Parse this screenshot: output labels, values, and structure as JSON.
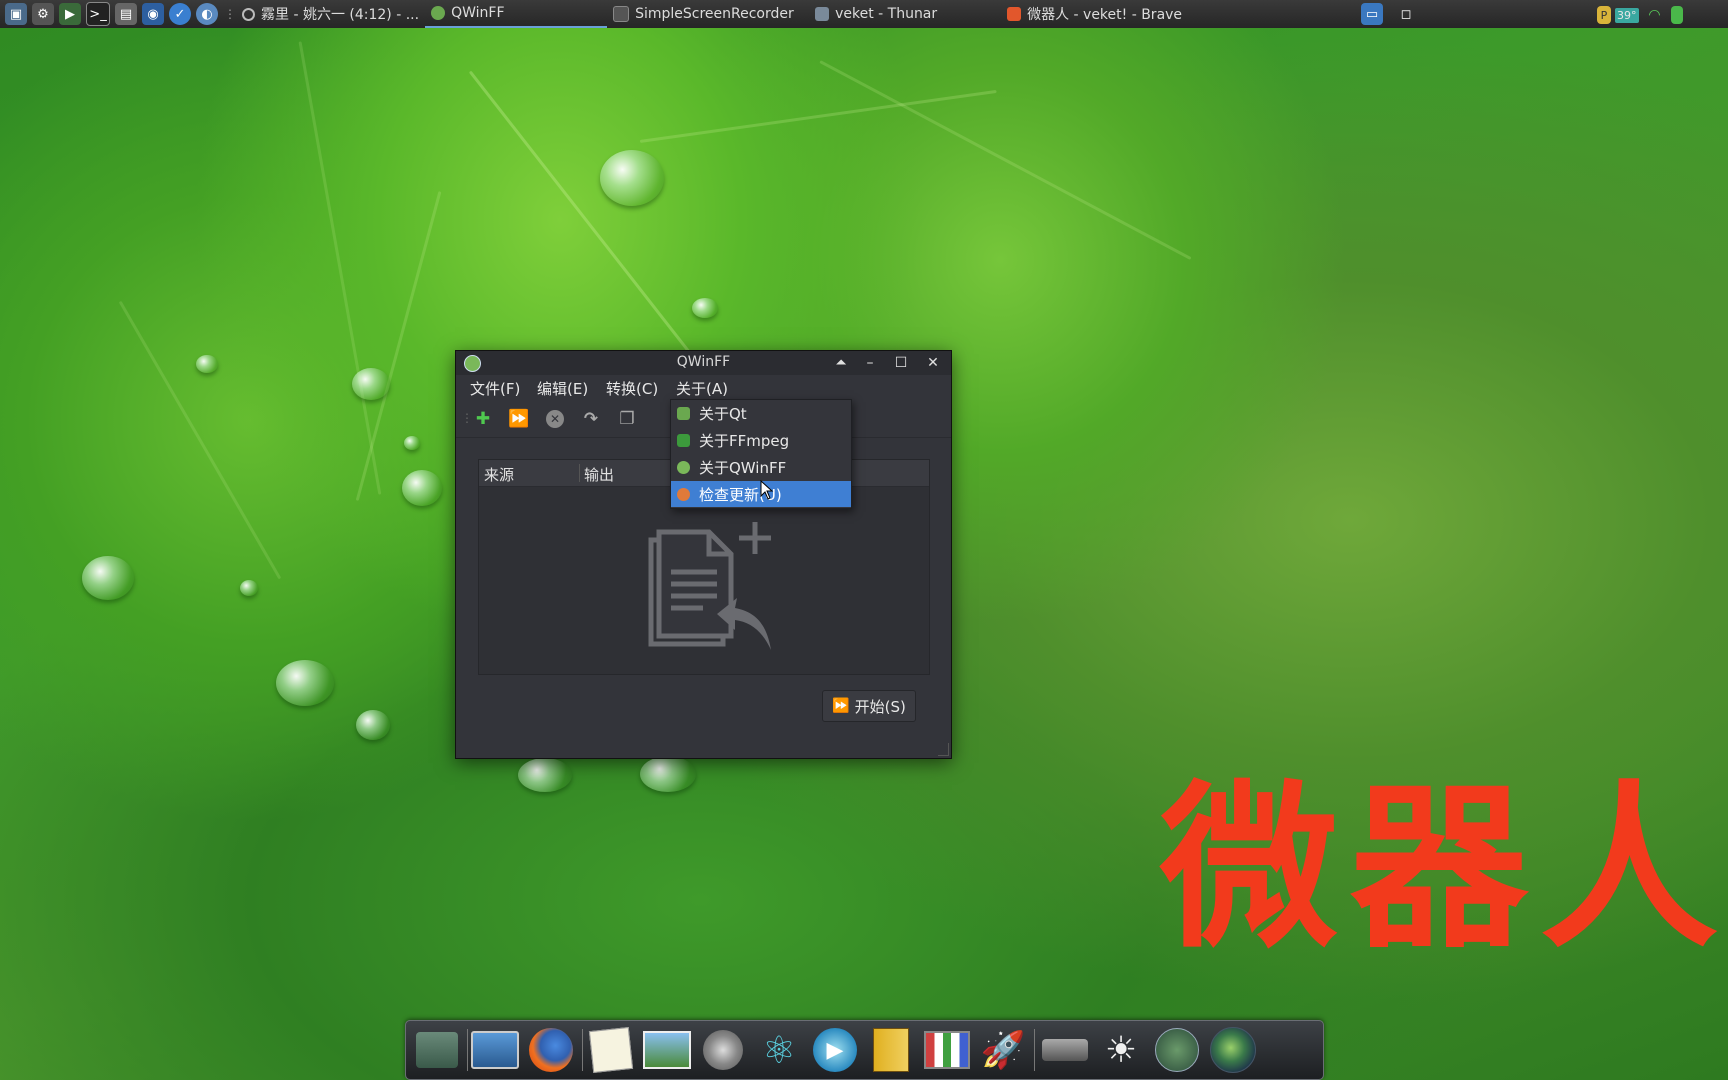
{
  "top_panel": {
    "tasks": [
      {
        "label": "霧里 - 姚六一 (4:12) - ...",
        "icon": "circle-icon"
      },
      {
        "label": "QWinFF",
        "icon": "qwinff-icon",
        "active": true
      },
      {
        "label": "SimpleScreenRecorder",
        "icon": "window-icon"
      },
      {
        "label": "veket - Thunar",
        "icon": "folder-icon"
      },
      {
        "label": "微器人 - veket! - Brave",
        "icon": "brave-icon"
      }
    ],
    "tray": {
      "temperature": "39°"
    }
  },
  "window": {
    "title": "QWinFF",
    "menu": {
      "file": "文件(F)",
      "edit": "编辑(E)",
      "convert": "转换(C)",
      "about": "关于(A)"
    },
    "list": {
      "col_source": "来源",
      "col_output": "输出"
    },
    "start_button": "开始(S)"
  },
  "about_menu": {
    "items": [
      {
        "label": "关于Qt",
        "icon": "qt-icon"
      },
      {
        "label": "关于FFmpeg",
        "icon": "ffmpeg-icon"
      },
      {
        "label": "关于QWinFF",
        "icon": "qwinff-icon"
      },
      {
        "label": "检查更新(U)",
        "icon": "update-icon",
        "highlighted": true
      }
    ]
  },
  "watermark": {
    "text": "微器人"
  },
  "colors": {
    "accent": "#3f7fd3",
    "watermark": "#f23a1c",
    "window_bg": "#33343a"
  }
}
